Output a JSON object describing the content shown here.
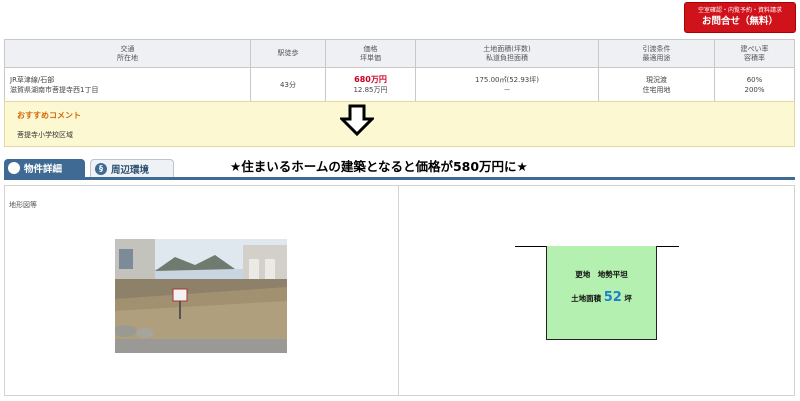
{
  "inquiry": {
    "line1": "空室確認・内覧予約・資料請求",
    "line2": "お問合せ（無料）"
  },
  "table": {
    "headers": [
      [
        "交通",
        "所在地"
      ],
      [
        "駅徒歩"
      ],
      [
        "価格",
        "坪単価"
      ],
      [
        "土地面積(坪数)",
        "私道負担面積"
      ],
      [
        "引渡条件",
        "最適用途"
      ],
      [
        "建ぺい率",
        "容積率"
      ]
    ],
    "row": {
      "transport": "JR草津線/石部",
      "address": "滋賀県湖南市菩提寺西1丁目",
      "walk": "43分",
      "price": "680万円",
      "unit_price": "12.85万円",
      "land_area": "175.00㎡(52.93坪)",
      "private_road": "－",
      "delivery": "現況渡",
      "usage": "住宅用地",
      "coverage": "60%",
      "floor_ratio": "200%"
    }
  },
  "recommend": {
    "title": "おすすめコメント",
    "body": "菩提寺小学校区域"
  },
  "tabs": {
    "detail": "物件詳細",
    "env": "周辺環境"
  },
  "headline": "★住まいるホームの建築となると価格が580万円に★",
  "panel_label": "地形図等",
  "plan": {
    "line1": "更地　地勢平坦",
    "area_prefix": "土地面積",
    "area_value": "52",
    "area_suffix": "坪"
  },
  "colors": {
    "accent": "#3f6a94",
    "price": "#c8001e",
    "button": "#d0121b",
    "plot": "#b4f0b0"
  }
}
